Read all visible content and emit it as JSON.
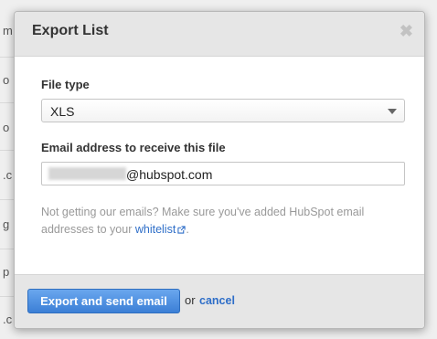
{
  "modal": {
    "title": "Export List",
    "close_symbol": "✖"
  },
  "file_type": {
    "label": "File type",
    "selected": "XLS"
  },
  "email": {
    "label": "Email address to receive this file",
    "value_visible": "@hubspot.com"
  },
  "hint": {
    "text_before": "Not getting our emails? Make sure you've added HubSpot email addresses to your ",
    "link_text": "whitelist",
    "text_after": "."
  },
  "footer": {
    "primary_label": "Export and send email",
    "or_text": "or",
    "cancel_label": "cancel"
  },
  "backdrop_rows": [
    "m",
    "o",
    "o",
    ".c",
    "g",
    "p",
    ".c"
  ],
  "colors": {
    "primary": "#3b7fd6",
    "link": "#2e6ec8",
    "header_bg": "#e6e6e6"
  }
}
